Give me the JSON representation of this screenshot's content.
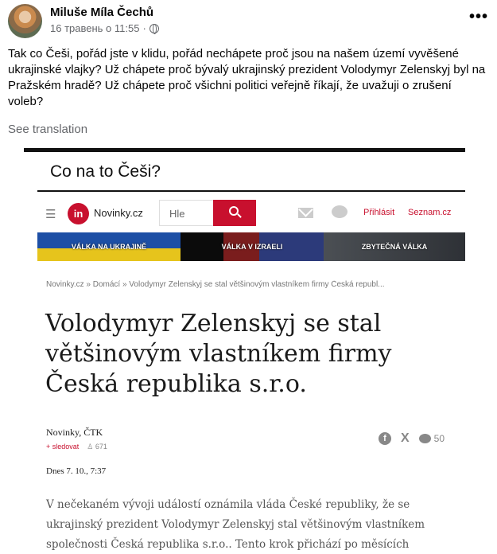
{
  "post": {
    "author": "Miluše Míla Čechů",
    "timestamp": "16 травень о 11:55",
    "separator": "·",
    "more_label": "•••",
    "text": "Tak co Češi, pořád jste v klidu, pořád nechápete proč jsou na našem území vyvěšené ukrajinské vlajky? Už chápete proč bývalý ukrajinský prezident Volodymyr Zelenskyj byl na Pražském hradě? Už chápete proč všichni politici veřejně říkají, že uvažuji o zrušení voleb?",
    "see_translation": "See translation"
  },
  "screenshot": {
    "title": "Co na to Češi?",
    "nav": {
      "hamburger": "☰",
      "logo_mark": "in",
      "logo_text": "Novinky.cz",
      "search_placeholder": "Hle",
      "login": "Přihlásit",
      "seznam": "Seznam.cz"
    },
    "banners": [
      {
        "label": "VÁLKA NA UKRAJINĚ"
      },
      {
        "label": "VÁLKA V IZRAELI"
      },
      {
        "label": "ZBYTEČNÁ VÁLKA"
      }
    ],
    "breadcrumb": "Novinky.cz » Domácí » Volodymyr Zelenskyj se stal většinovým vlastníkem firmy Česká republ...",
    "headline": "Volodymyr Zelenskyj se stal většinovým vlastníkem firmy Česká republika s.r.o.",
    "source": "Novinky, ČTK",
    "follow": "+ sledovat",
    "followers": "♙ 671",
    "share": {
      "facebook": "f",
      "x": "X",
      "comments": "50"
    },
    "date": "Dnes 7. 10., 7:37",
    "body": "V nečekaném vývoji událostí oznámila vláda České republiky, že se ukrajinský prezident Volodymyr Zelenskyj stal většinovým vlastníkem společnosti Česká republika s.r.o.. Tento krok přichází po měsících"
  },
  "colors": {
    "brand_red": "#c8102e",
    "meta_gray": "#65676b"
  }
}
